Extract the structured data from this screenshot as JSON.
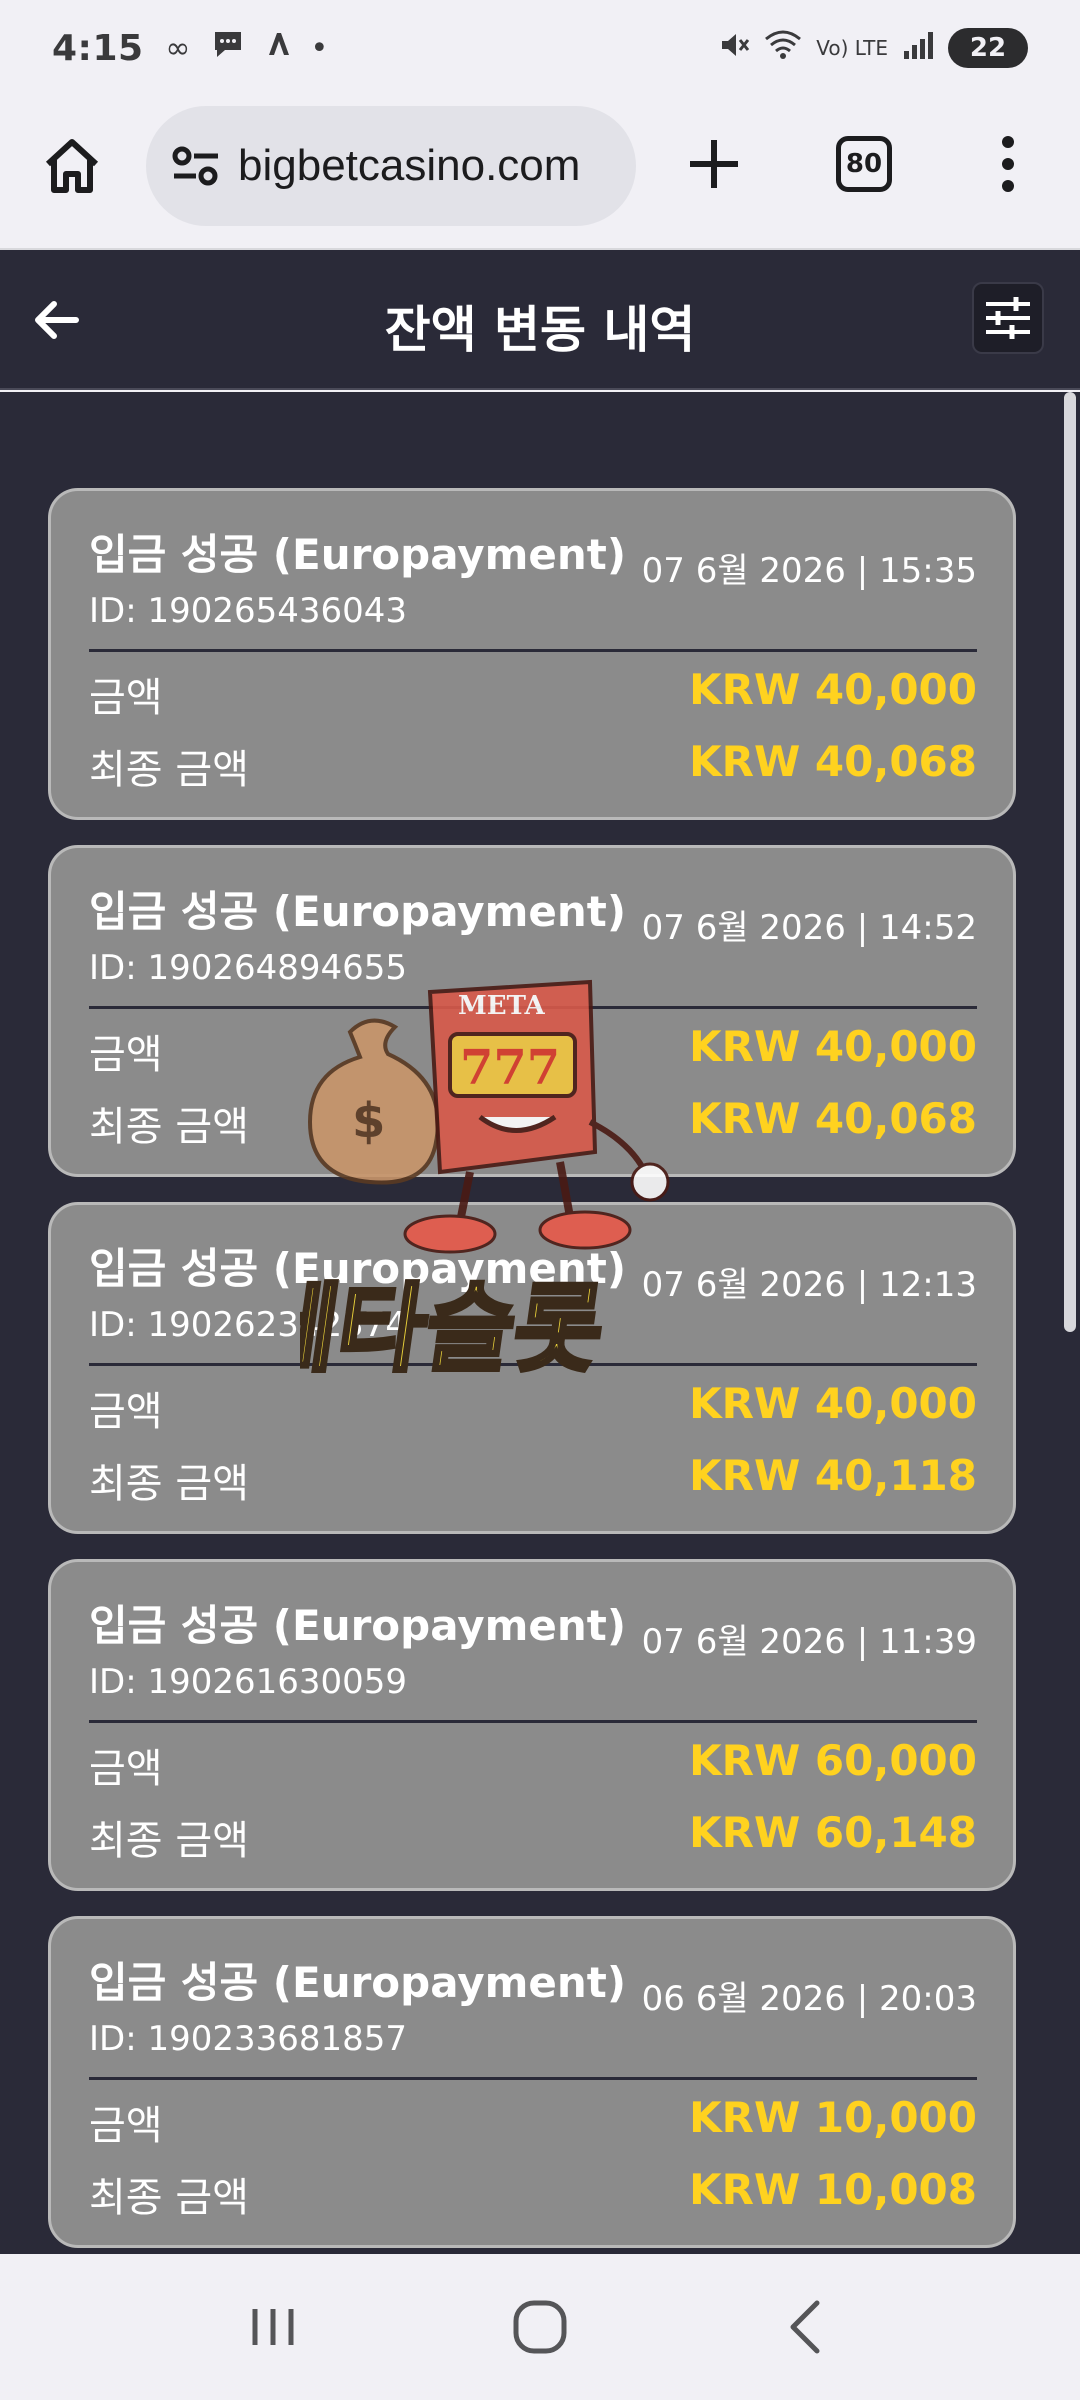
{
  "status": {
    "time": "4:15",
    "battery": "22",
    "network": "Vo) LTE"
  },
  "browser": {
    "url": "bigbetcasino.com",
    "tab_count": "80"
  },
  "header": {
    "title": "잔액 변동 내역"
  },
  "labels": {
    "amount": "금액",
    "final_amount": "최종 금액"
  },
  "transactions": [
    {
      "title": "입금 성공 (Europayment)",
      "date": "07 6월 2026 | 15:35",
      "id": "ID: 190265436043",
      "amount": "KRW 40,000",
      "final_amount": "KRW 40,068"
    },
    {
      "title": "입금 성공 (Europayment)",
      "date": "07 6월 2026 | 14:52",
      "id": "ID: 190264894655",
      "amount": "KRW 40,000",
      "final_amount": "KRW 40,068"
    },
    {
      "title": "입금 성공 (Europayment)",
      "date": "07 6월 2026 | 12:13",
      "id": "ID: 190262342374",
      "amount": "KRW 40,000",
      "final_amount": "KRW 40,118"
    },
    {
      "title": "입금 성공 (Europayment)",
      "date": "07 6월 2026 | 11:39",
      "id": "ID: 190261630059",
      "amount": "KRW 60,000",
      "final_amount": "KRW 60,148"
    },
    {
      "title": "입금 성공 (Europayment)",
      "date": "06 6월 2026 | 20:03",
      "id": "ID: 190233681857",
      "amount": "KRW 10,000",
      "final_amount": "KRW 10,008"
    }
  ],
  "watermark": {
    "badge": "META",
    "reels": "777",
    "text": "메타슬롯"
  },
  "colors": {
    "background": "#2a2a38",
    "card": "#8b8b8b",
    "amount": "#ffd21f"
  }
}
